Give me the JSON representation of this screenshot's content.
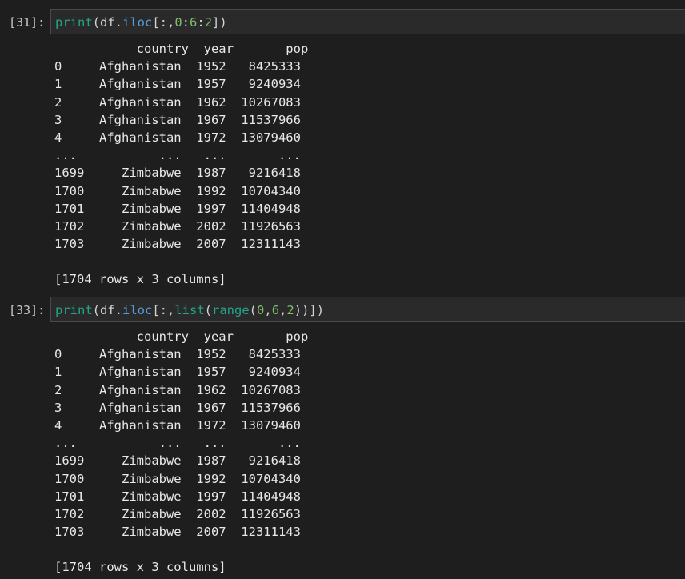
{
  "cells": [
    {
      "prompt": "[31]:",
      "code_parts": [
        {
          "text": "print",
          "cls": "fn"
        },
        {
          "text": "(df.",
          "cls": ""
        },
        {
          "text": "iloc",
          "cls": "attr"
        },
        {
          "text": "[:,",
          "cls": ""
        },
        {
          "text": "0",
          "cls": "num"
        },
        {
          "text": ":",
          "cls": ""
        },
        {
          "text": "6",
          "cls": "num"
        },
        {
          "text": ":",
          "cls": ""
        },
        {
          "text": "2",
          "cls": "num"
        },
        {
          "text": "])",
          "cls": ""
        }
      ],
      "header": "           country  year       pop",
      "rows": [
        "0     Afghanistan  1952   8425333",
        "1     Afghanistan  1957   9240934",
        "2     Afghanistan  1962  10267083",
        "3     Afghanistan  1967  11537966",
        "4     Afghanistan  1972  13079460",
        "...           ...   ...       ...",
        "1699     Zimbabwe  1987   9216418",
        "1700     Zimbabwe  1992  10704340",
        "1701     Zimbabwe  1997  11404948",
        "1702     Zimbabwe  2002  11926563",
        "1703     Zimbabwe  2007  12311143"
      ],
      "summary": "[1704 rows x 3 columns]"
    },
    {
      "prompt": "[33]:",
      "code_parts": [
        {
          "text": "print",
          "cls": "fn"
        },
        {
          "text": "(df.",
          "cls": ""
        },
        {
          "text": "iloc",
          "cls": "attr"
        },
        {
          "text": "[:,",
          "cls": ""
        },
        {
          "text": "list",
          "cls": "fn"
        },
        {
          "text": "(",
          "cls": ""
        },
        {
          "text": "range",
          "cls": "fn"
        },
        {
          "text": "(",
          "cls": ""
        },
        {
          "text": "0",
          "cls": "num"
        },
        {
          "text": ",",
          "cls": ""
        },
        {
          "text": "6",
          "cls": "num"
        },
        {
          "text": ",",
          "cls": ""
        },
        {
          "text": "2",
          "cls": "num"
        },
        {
          "text": "))])",
          "cls": ""
        }
      ],
      "header": "           country  year       pop",
      "rows": [
        "0     Afghanistan  1952   8425333",
        "1     Afghanistan  1957   9240934",
        "2     Afghanistan  1962  10267083",
        "3     Afghanistan  1967  11537966",
        "4     Afghanistan  1972  13079460",
        "...           ...   ...       ...",
        "1699     Zimbabwe  1987   9216418",
        "1700     Zimbabwe  1992  10704340",
        "1701     Zimbabwe  1997  11404948",
        "1702     Zimbabwe  2002  11926563",
        "1703     Zimbabwe  2007  12311143"
      ],
      "summary": "[1704 rows x 3 columns]"
    }
  ]
}
